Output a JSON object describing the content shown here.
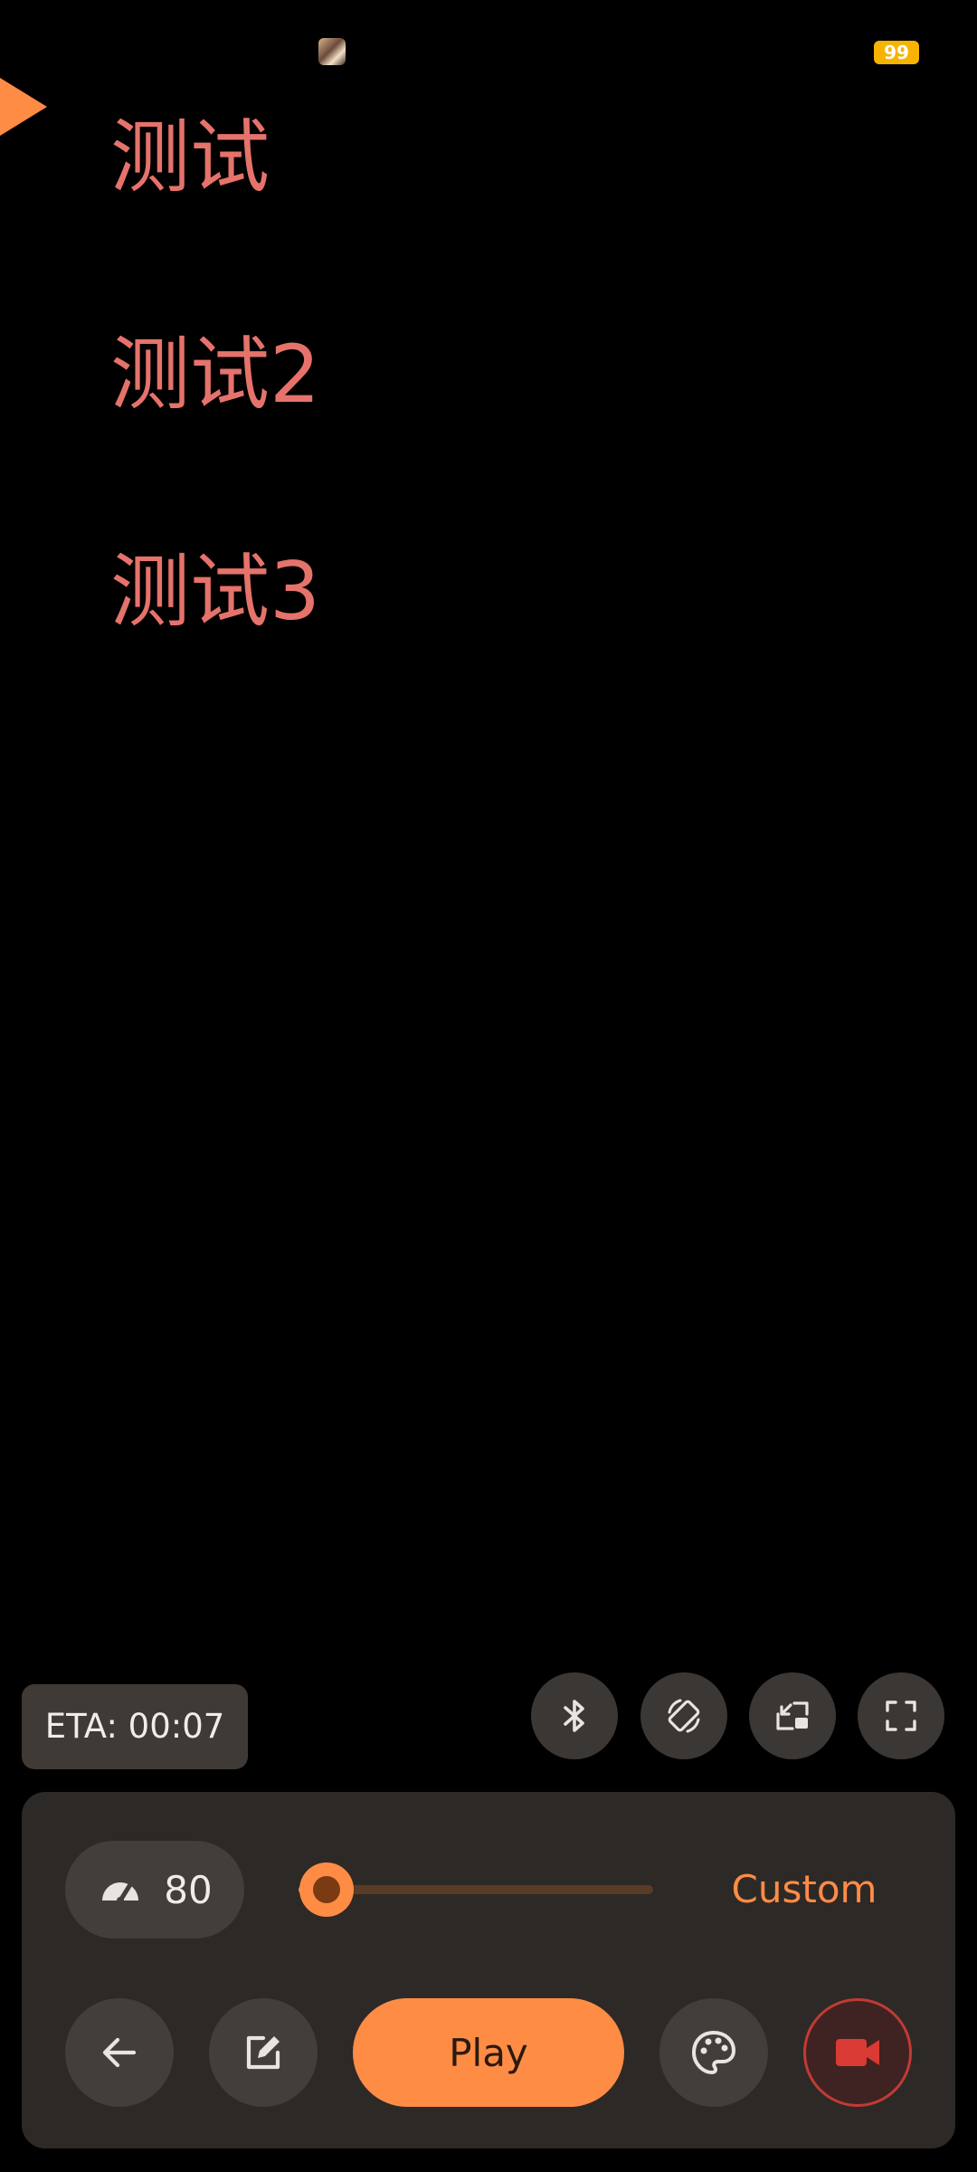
{
  "status_bar": {
    "battery_level": "99",
    "colors": {
      "battery": "#f6b400"
    }
  },
  "lines": [
    "测试",
    "测试2",
    "测试3"
  ],
  "eta": {
    "label": "ETA: 00:07"
  },
  "quick_actions": [
    {
      "icon": "bluetooth-icon"
    },
    {
      "icon": "screen-rotation-icon"
    },
    {
      "icon": "picture-in-picture-icon"
    },
    {
      "icon": "fullscreen-icon"
    }
  ],
  "controls": {
    "speed": {
      "icon": "speedometer-icon",
      "value": "80",
      "slider_fraction": 0.08
    },
    "preset_label": "Custom",
    "buttons": {
      "back": "arrow-left-icon",
      "edit": "edit-icon",
      "play_label": "Play",
      "palette": "palette-icon",
      "record": "video-camera-icon"
    }
  },
  "colors": {
    "accent": "#ff8c45",
    "text_line": "#e5736b",
    "panel_bg": "#2d2926",
    "record": "#d93a33"
  }
}
